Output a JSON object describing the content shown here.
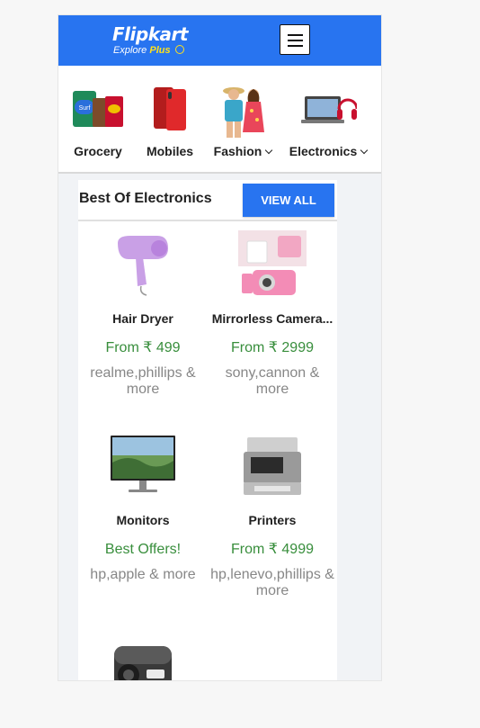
{
  "header": {
    "logo_title": "Flipkart",
    "logo_sub": "Explore",
    "logo_plus": "Plus",
    "brand_color": "#2874f0",
    "menu_icon": "hamburger-icon"
  },
  "categories": [
    {
      "label": "Grocery",
      "icon": "grocery-icon"
    },
    {
      "label": "Mobiles",
      "icon": "mobile-phone-icon"
    },
    {
      "label": "Fashion",
      "icon": "fashion-icon",
      "dropdown": true
    },
    {
      "label": "Electronics",
      "icon": "laptop-icon",
      "dropdown": true
    }
  ],
  "section": {
    "title": "Best Of Electronics",
    "view_all": "VIEW ALL",
    "items": [
      {
        "name": "Hair Dryer",
        "price": "From ₹ 499",
        "brands": "realme,phillips & more"
      },
      {
        "name": "Mirrorless Camera...",
        "price": "From ₹ 2999",
        "brands": "sony,cannon & more"
      },
      {
        "name": "Monitors",
        "price": "Best Offers!",
        "brands": "hp,apple & more"
      },
      {
        "name": "Printers",
        "price": "From ₹ 4999",
        "brands": "hp,lenevo,phillips & more"
      }
    ]
  },
  "colors": {
    "price_green": "#388e3c",
    "muted": "#878787"
  }
}
